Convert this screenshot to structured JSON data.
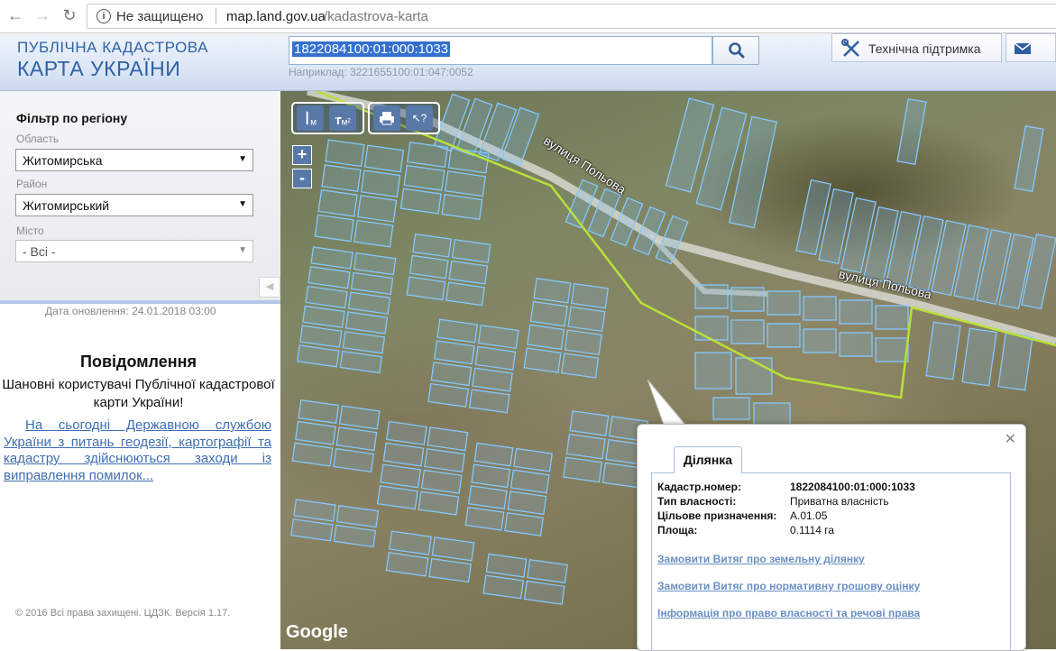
{
  "browser": {
    "security_text": "Не защищено",
    "url_host": "map.land.gov.ua",
    "url_path": "/kadastrova-karta"
  },
  "header": {
    "logo_line1": "ПУБЛІЧНА КАДАСТРОВА",
    "logo_line2": "КАРТА УКРАЇНИ",
    "search_value": "1822084100:01:000:1033",
    "search_hint": "Наприклад: 3221655100:01:047:0052",
    "support_label": "Технічна підтримка"
  },
  "filter": {
    "title": "Фільтр по регіону",
    "oblast_label": "Область",
    "oblast_value": "Житомирська",
    "rayon_label": "Район",
    "rayon_value": "Житомирський",
    "city_label": "Місто",
    "city_value": "- Всі -"
  },
  "sidebar": {
    "update_date": "Дата оновлення: 24.01.2018 03:00",
    "notice_title": "Повідомлення",
    "notice_greeting": "Шановні користувачі Публічної кадастрової карти України!",
    "notice_link": "На сьогодні Державною службою України з питань геодезії, картографії та кадастру здійснюються заходи із виправлення помилок...",
    "copyright": "© 2016 Всі права захищені. ЦДЗК. Версія 1.17."
  },
  "map": {
    "tool_measure_label": "м",
    "tool_area_label": "м²",
    "zoom_in": "+",
    "zoom_out": "-",
    "street_label_1": "вулиця Польова",
    "street_label_2": "вулиця Польова",
    "attribution": "Google"
  },
  "popup": {
    "tab_label": "Ділянка",
    "rows": [
      {
        "label": "Кадастр.номер:",
        "value": "1822084100:01:000:1033"
      },
      {
        "label": "Тип власності:",
        "value": "Приватна власність"
      },
      {
        "label": "Цільове призначення:",
        "value": "А.01.05"
      },
      {
        "label": "Площа:",
        "value": "0.1114 га"
      }
    ],
    "links": [
      "Замовити Витяг про земельну ділянку",
      "Замовити Витяг про нормативну грошову оцінку",
      "Інформація про право власності та речові права"
    ]
  },
  "colors": {
    "parcel_outline": "#7fc4ff",
    "boundary_line": "#b9e03a",
    "road": "#d9d9d4",
    "accent": "#2e62a8"
  }
}
